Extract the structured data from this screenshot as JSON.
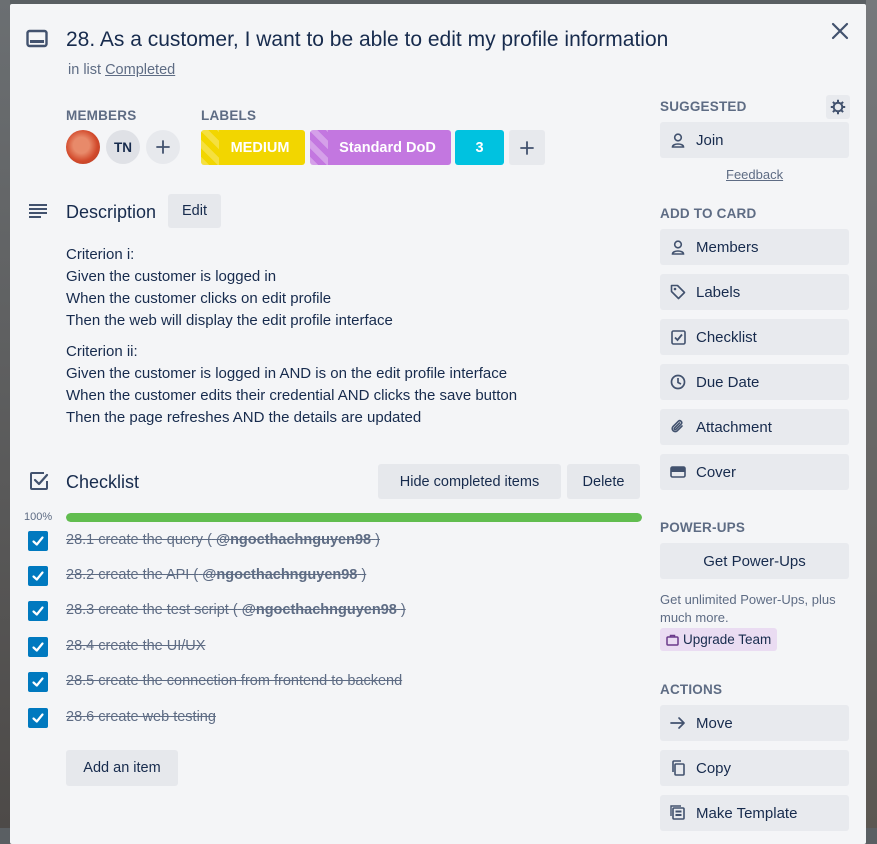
{
  "card": {
    "title": "28. As a customer, I want to be able to edit my profile information",
    "in_list_prefix": "in list",
    "list_name": "Completed"
  },
  "members": {
    "heading": "MEMBERS",
    "initials": "TN"
  },
  "labels": {
    "heading": "LABELS",
    "items": [
      {
        "text": "MEDIUM",
        "color": "#f2d600"
      },
      {
        "text": "Standard DoD",
        "color": "#c377e0"
      },
      {
        "text": "3",
        "color": "#00c2e0"
      }
    ]
  },
  "description": {
    "heading": "Description",
    "edit_label": "Edit",
    "paragraphs": [
      {
        "lines": [
          "Criterion i:",
          "Given the customer is logged in",
          "When the customer clicks on edit profile",
          "Then the web will display the edit profile interface"
        ]
      },
      {
        "lines": [
          "Criterion ii:",
          "Given the customer is logged in AND is on the edit profile interface",
          "When the customer edits their credential AND clicks the save button",
          "Then the page refreshes AND the details are updated"
        ]
      }
    ]
  },
  "checklist": {
    "heading": "Checklist",
    "hide_label": "Hide completed items",
    "delete_label": "Delete",
    "progress_text": "100%",
    "progress": 1.0,
    "items": [
      {
        "text": "28.1 create the query (",
        "mention": "@ngocthachnguyen98",
        "suffix": ")"
      },
      {
        "text": "28.2 create the API (",
        "mention": "@ngocthachnguyen98",
        "suffix": ")"
      },
      {
        "text": "28.3 create the test script (",
        "mention": "@ngocthachnguyen98",
        "suffix": ")"
      },
      {
        "text": "28.4 create the UI/UX",
        "mention": "",
        "suffix": ""
      },
      {
        "text": "28.5 create the connection from frontend to backend",
        "mention": "",
        "suffix": ""
      },
      {
        "text": "28.6 create web testing",
        "mention": "",
        "suffix": ""
      }
    ],
    "add_item_label": "Add an item"
  },
  "sidebar": {
    "suggested_heading": "SUGGESTED",
    "join_label": "Join",
    "feedback_label": "Feedback",
    "add_to_card_heading": "ADD TO CARD",
    "add_to_card": [
      {
        "label": "Members",
        "icon": "person-icon"
      },
      {
        "label": "Labels",
        "icon": "tag-icon"
      },
      {
        "label": "Checklist",
        "icon": "checkbox-icon"
      },
      {
        "label": "Due Date",
        "icon": "clock-icon"
      },
      {
        "label": "Attachment",
        "icon": "paperclip-icon"
      },
      {
        "label": "Cover",
        "icon": "cover-icon"
      }
    ],
    "powerups_heading": "POWER-UPS",
    "get_powerups_label": "Get Power-Ups",
    "powerups_text": "Get unlimited Power-Ups, plus much more.",
    "upgrade_label": "Upgrade Team",
    "actions_heading": "ACTIONS",
    "actions": [
      {
        "label": "Move",
        "icon": "arrow-right-icon"
      },
      {
        "label": "Copy",
        "icon": "copy-icon"
      },
      {
        "label": "Make Template",
        "icon": "template-icon"
      }
    ]
  }
}
